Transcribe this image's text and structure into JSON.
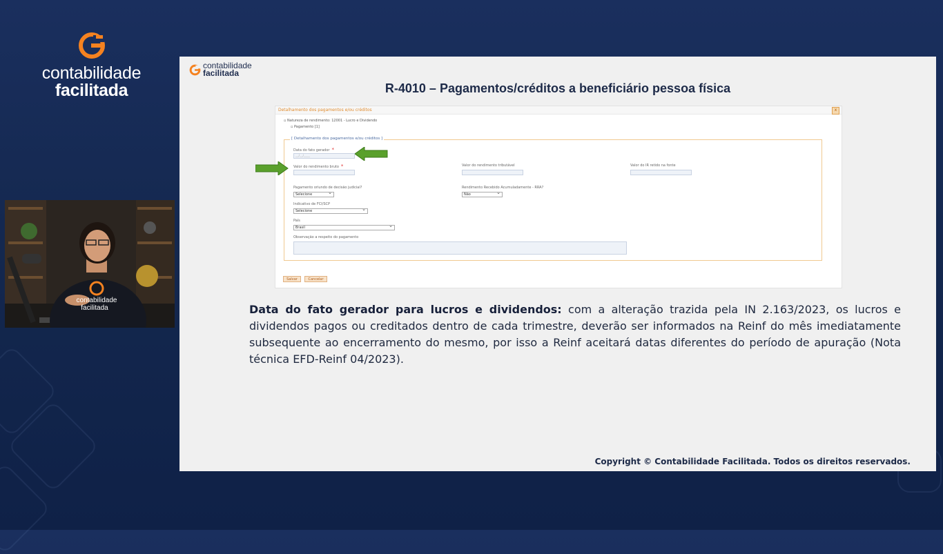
{
  "brand": {
    "name_line1": "contabilidade",
    "name_line2": "facilitada",
    "accent_color": "#f58220"
  },
  "slide": {
    "logo_line1": "contabilidade",
    "logo_line2": "facilitada",
    "title": "R-4010 – Pagamentos/créditos a beneficiário pessoa física",
    "copyright": "Copyright © Contabilidade Facilitada. Todos os direitos reservados."
  },
  "form": {
    "header": "Detalhamento dos pagamentos e/ou créditos",
    "close_icon": "close-icon",
    "tree_natureza": "Natureza de rendimento: 12001 - Lucro e Dividendo",
    "tree_pagamento": "Pagamento [1]",
    "legend": "[ Detalhamento dos pagamentos e/ou créditos ]",
    "data_fato_gerador_label": "Data do fato gerador",
    "data_fato_gerador_placeholder": "__/__/____",
    "valor_rendimento_bruto_label": "Valor do rendimento bruto",
    "valor_rendimento_tributavel_label": "Valor do rendimento tributável",
    "valor_ir_retido_label": "Valor do IR retido na fonte",
    "pagamento_decisao_judicial_label": "Pagamento oriundo de decisão judicial?",
    "pagamento_decisao_judicial_value": "Selecione",
    "rra_label": "Rendimento Recebido Acumuladamente - RRA?",
    "rra_value": "Não",
    "fci_scp_label": "Indicativo de FCI/SCP",
    "fci_scp_value": "Selecione",
    "pais_label": "País",
    "pais_value": "Brasil",
    "observacao_label": "Observação a respeito do pagamento",
    "salvar_label": "Salvar",
    "cancelar_label": "Cancelar",
    "required_mark": "*",
    "arrow_color": "#5aa02c"
  },
  "description": {
    "bold_lead": "Data do fato gerador para lucros e dividendos:",
    "body": " com a alteração trazida pela IN 2.163/2023, os lucros e dividendos pagos ou creditados dentro de cada trimestre, deverão ser informados na Reinf do mês imediatamente subsequente ao encerramento do mesmo, por isso a Reinf aceitará datas diferentes do período de apuração (Nota técnica EFD-Reinf 04/2023)."
  },
  "webcam": {
    "shirt_line1": "contabilidade",
    "shirt_line2": "facilitada"
  }
}
